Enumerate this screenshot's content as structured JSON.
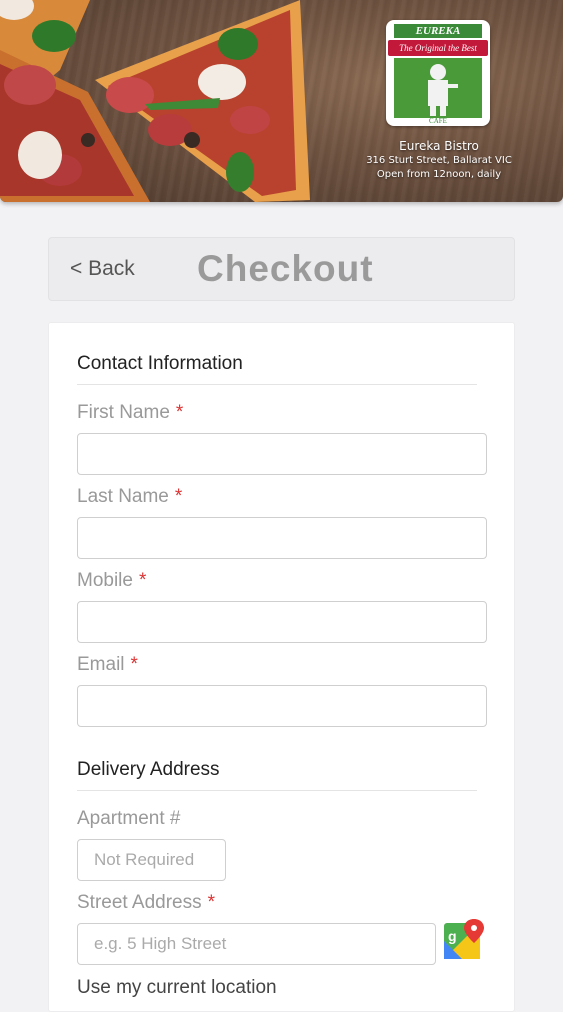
{
  "header": {
    "logo": {
      "top_text": "EUREKA",
      "ribbon_text": "The Original the Best",
      "bottom_text": "CAFÉ"
    },
    "bistro_name": "Eureka Bistro",
    "address": "316 Sturt Street, Ballarat VIC",
    "hours": "Open from 12noon, daily"
  },
  "nav": {
    "back_label": "< Back",
    "title": "Checkout"
  },
  "form": {
    "contact_section": "Contact Information",
    "first_name_label": "First Name",
    "last_name_label": "Last Name",
    "mobile_label": "Mobile",
    "email_label": "Email",
    "required_marker": "*",
    "delivery_section": "Delivery Address",
    "apartment_label": "Apartment #",
    "apartment_placeholder": "Not Required",
    "street_label": "Street Address",
    "street_placeholder": "e.g. 5 High Street",
    "use_location_label": "Use my current location"
  },
  "colors": {
    "required": "#dd3333",
    "brand_green": "#3a8a3a",
    "brand_red": "#c2183a"
  }
}
